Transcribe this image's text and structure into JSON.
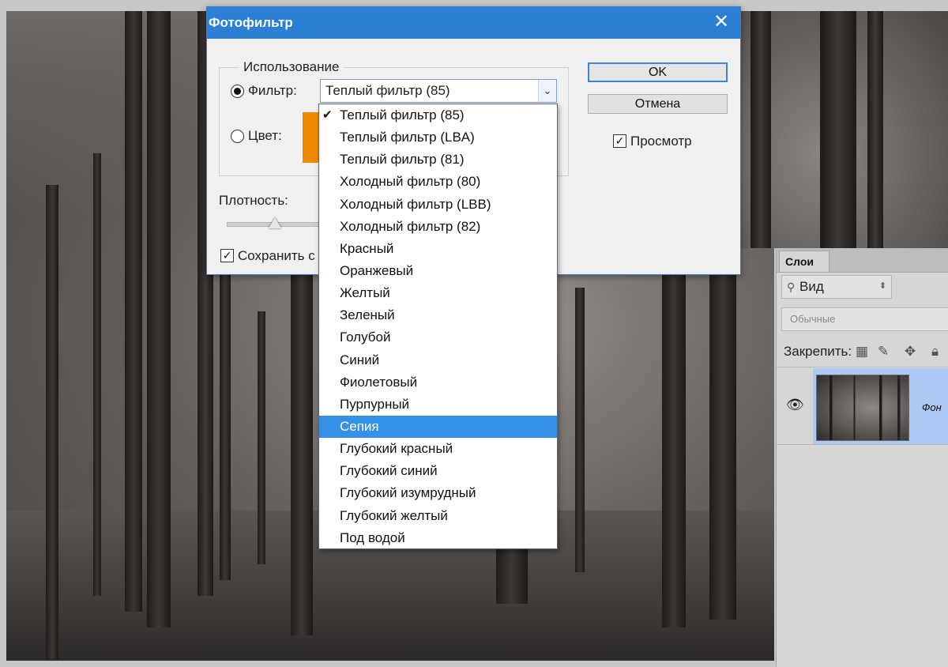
{
  "dialog": {
    "title": "Фотофильтр",
    "close_glyph": "✕",
    "group_title": "Использование",
    "filter_label": "Фильтр:",
    "color_label": "Цвет:",
    "selected_filter": "Теплый фильтр (85)",
    "density_label": "Плотность:",
    "preserve_label": "Сохранить с",
    "ok_label": "OK",
    "cancel_label": "Отмена",
    "preview_label": "Просмотр",
    "filter_radio_selected": true,
    "preview_checked": true,
    "preserve_checked": true,
    "swatch_color": "#ee8a00"
  },
  "dropdown": {
    "items": [
      {
        "label": "Теплый фильтр (85)",
        "checked": true
      },
      {
        "label": "Теплый фильтр (LBA)"
      },
      {
        "label": "Теплый фильтр (81)"
      },
      {
        "label": "Холодный фильтр (80)"
      },
      {
        "label": "Холодный фильтр (LBB)"
      },
      {
        "label": "Холодный фильтр (82)"
      },
      {
        "label": "Красный"
      },
      {
        "label": "Оранжевый"
      },
      {
        "label": "Желтый"
      },
      {
        "label": "Зеленый"
      },
      {
        "label": "Голубой"
      },
      {
        "label": "Синий"
      },
      {
        "label": "Фиолетовый"
      },
      {
        "label": "Пурпурный"
      },
      {
        "label": "Сепия",
        "highlighted": true
      },
      {
        "label": "Глубокий красный"
      },
      {
        "label": "Глубокий синий"
      },
      {
        "label": "Глубокий изумрудный"
      },
      {
        "label": "Глубокий желтый"
      },
      {
        "label": "Под водой"
      }
    ],
    "highlight_color": "#3591e8"
  },
  "layers_panel": {
    "tab": "Слои",
    "search_placeholder": "Вид",
    "blend_mode": "Обычные",
    "lock_label": "Закрепить:",
    "layer_name": "Фон",
    "selection_color": "#aec8f4"
  }
}
